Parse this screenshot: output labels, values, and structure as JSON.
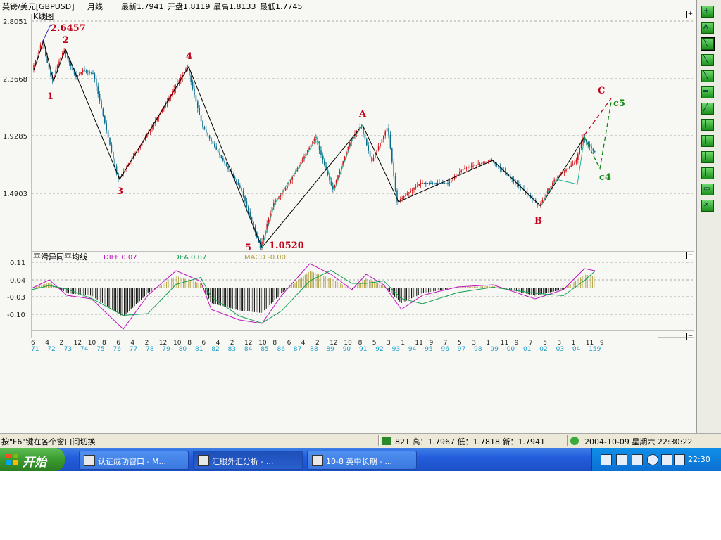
{
  "header": {
    "title": "英镑/美元[GBPUSD]",
    "period": "月线",
    "latest": "最新1.7941",
    "open": "开盘1.8119",
    "high": "最高1.8133",
    "low": "最低1.7745",
    "kline_label": "K线图"
  },
  "price_axis": [
    "2.8051",
    "2.3668",
    "1.9285",
    "1.4903"
  ],
  "wave_labels": {
    "w1": "1",
    "w2": "2",
    "w3": "3",
    "w4": "4",
    "w5": "5",
    "wa": "A",
    "wb": "B",
    "wc": "C",
    "c4": "c4",
    "c5": "c5",
    "peak": "2.6457",
    "bottom": "1.0520"
  },
  "macd": {
    "title": "平滑异同平均线",
    "diff": "DIFF 0.07",
    "dea": "DEA 0.07",
    "macd": "MACD -0.00",
    "axis": [
      "0.11",
      "0.04",
      "-0.03",
      "-0.10"
    ]
  },
  "time_axis": {
    "months": [
      "6",
      "4",
      "2",
      "12",
      "10",
      "8",
      "6",
      "4",
      "2",
      "12",
      "10",
      "8",
      "6",
      "4",
      "2",
      "12",
      "10",
      "8",
      "6",
      "4",
      "2",
      "12",
      "10",
      "8",
      "5",
      "3",
      "1",
      "11",
      "9",
      "7",
      "5",
      "3",
      "1",
      "11",
      "9",
      "7",
      "5",
      "3",
      "1",
      "11",
      "9"
    ],
    "years": [
      "71",
      "72",
      "73",
      "74",
      "75",
      "76",
      "77",
      "78",
      "79",
      "80",
      "81",
      "82",
      "83",
      "84",
      "85",
      "86",
      "87",
      "88",
      "89",
      "90",
      "91",
      "92",
      "93",
      "94",
      "95",
      "96",
      "97",
      "98",
      "99",
      "00",
      "01",
      "02",
      "03",
      "04",
      "159"
    ]
  },
  "status": {
    "hint": "按\"F6\"键在各个窗口间切换",
    "quote": "821 高：1.7967 低：1.7818 新：1.7941",
    "datetime": "2004-10-09 星期六 22:30:22"
  },
  "taskbar": {
    "start": "开始",
    "tasks": [
      "认证成功窗口 - M...",
      "汇眼外汇分析 - ...",
      "10-8 英中长期 - ..."
    ],
    "clock": "22:30"
  },
  "colors": {
    "up_candle": "#d2161a",
    "down_candle": "#0a6e8f",
    "wave_red": "#c0001a",
    "wave_green": "#118811",
    "diff_line": "#c010c0",
    "dea_line": "#10a050",
    "macd_pos": "#b0a040",
    "macd_neg": "#000000"
  }
}
